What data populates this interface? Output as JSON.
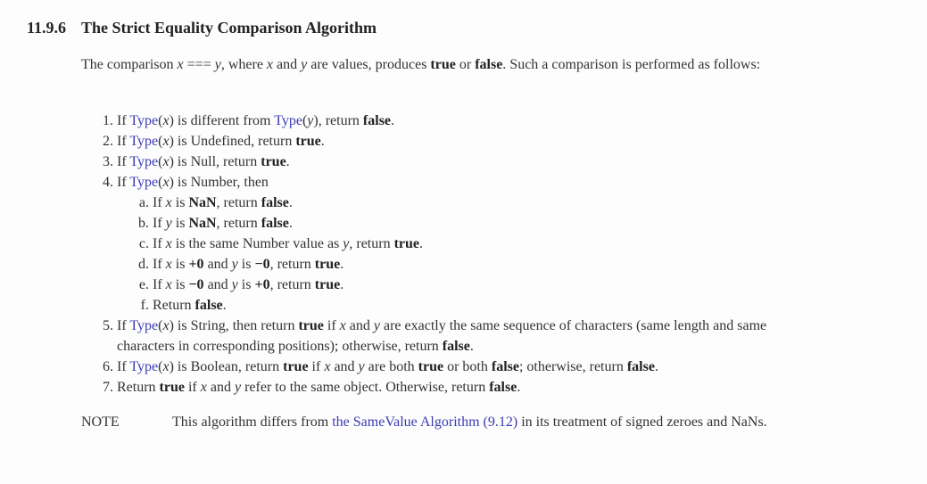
{
  "section": {
    "number": "11.9.6",
    "title": "The Strict Equality Comparison Algorithm"
  },
  "intro": {
    "p1": "The comparison ",
    "x": "x",
    "op": " === ",
    "y": "y",
    "p2": ", where ",
    "p3": " and ",
    "p4": " are values, produces ",
    "true": "true",
    "p5": " or ",
    "false": "false",
    "p6": ". Such a comparison is performed as follows:"
  },
  "words": {
    "if": "If ",
    "type": "Type",
    "lp": "(",
    "rp": ")",
    "x": "x",
    "y": "y",
    "true": "true",
    "false": "false",
    "nan": "NaN",
    "return": ", return ",
    "period": ".",
    "is": " is ",
    "and": " and "
  },
  "steps": {
    "m1": "1.",
    "m2": "2.",
    "m3": "3.",
    "m4": "4.",
    "m5": "5.",
    "m6": "6.",
    "m7": "7.",
    "ma": "a.",
    "mb": "b.",
    "mc": "c.",
    "md": "d.",
    "me": "e.",
    "mf": "f.",
    "s1_mid": " is different from ",
    "s2_mid": " is Undefined",
    "s3_mid": " is Null",
    "s4_mid": " is Number, then",
    "sc_mid": " is the same Number value as ",
    "plus_zero": "+0",
    "minus_zero": "−0",
    "sf_text": "Return ",
    "s5_a": " is String, then return ",
    "s5_b": " if ",
    "s5_c": " are exactly the same sequence of characters (same length and same characters in corresponding positions); otherwise, return ",
    "s6_a": " is Boolean, return ",
    "s6_b": " are both ",
    "s6_c": " or both ",
    "s6_d": "; otherwise, return ",
    "s7_a": "Return ",
    "s7_b": " refer to the same object. Otherwise, return "
  },
  "note": {
    "label": "NOTE",
    "t1": "This algorithm differs from ",
    "link": "the SameValue Algorithm (9.12)",
    "t2": " in its treatment of signed zeroes and NaNs."
  },
  "colors": {
    "link": "#3b3bb5",
    "text": "#333333"
  }
}
